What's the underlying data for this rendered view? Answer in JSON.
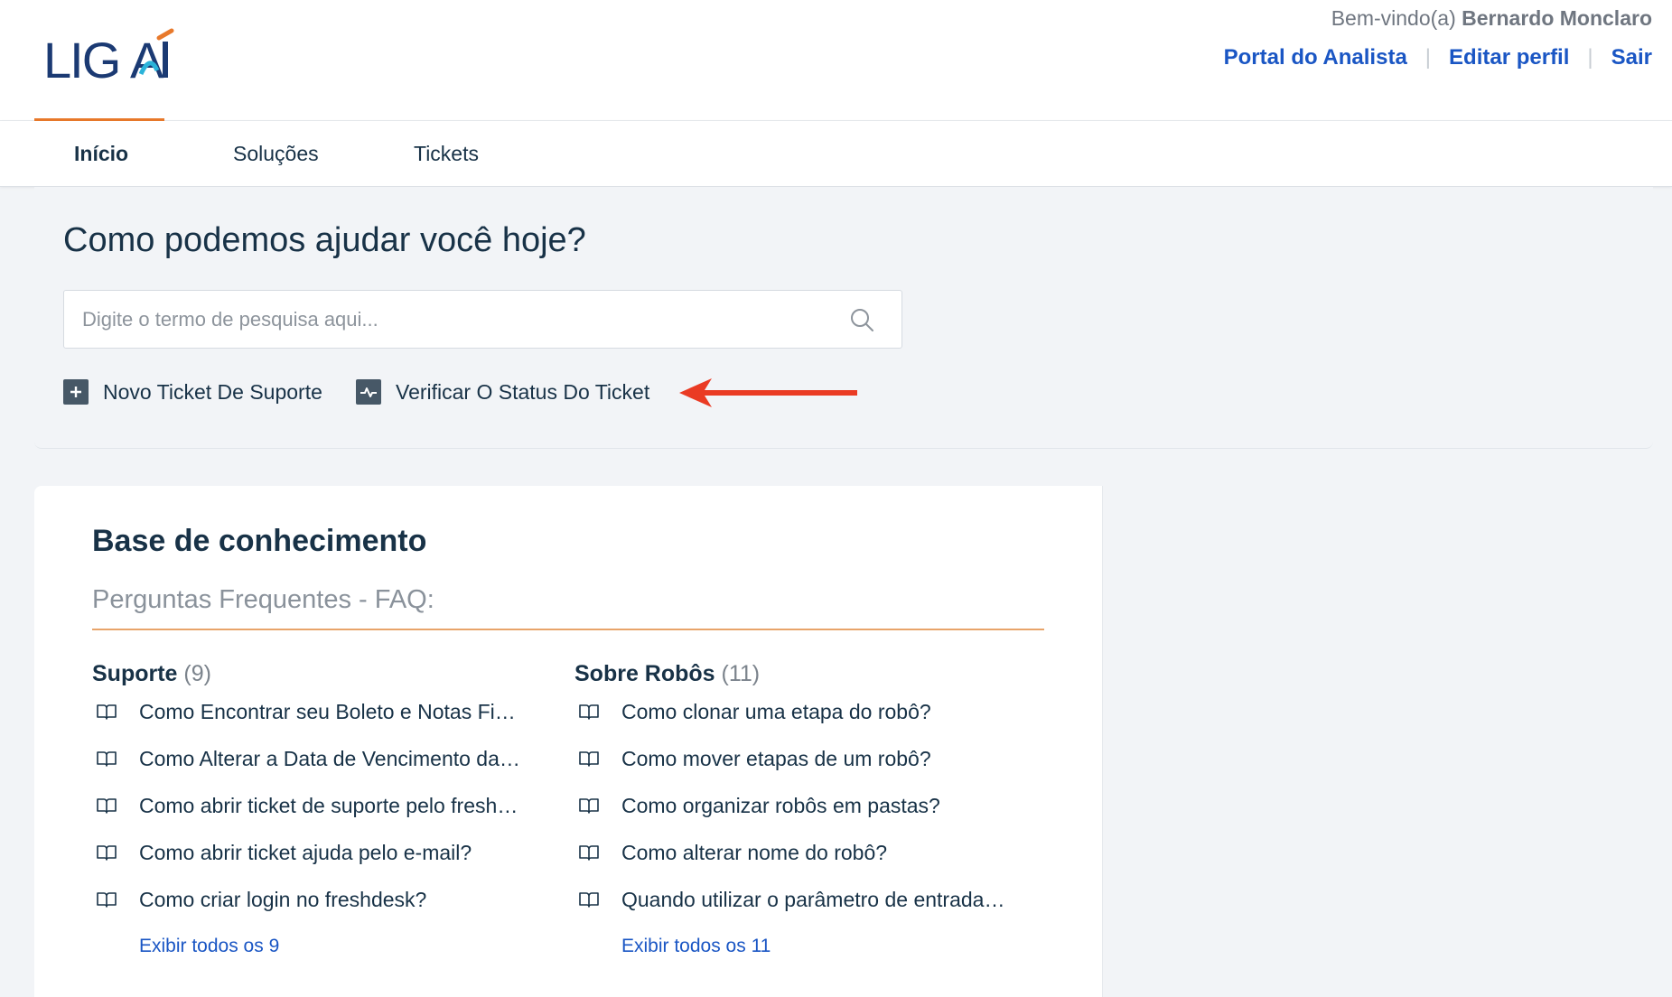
{
  "brand": {
    "logo_text": "LIGAÍ",
    "colors": {
      "blue": "#1b3a73",
      "accent_orange": "#e8792b",
      "accent_cyan": "#2bb3d9"
    }
  },
  "user": {
    "welcome_prefix": "Bem-vindo(a)",
    "name": "Bernardo Monclaro"
  },
  "top_links": {
    "portal": "Portal do Analista",
    "edit_profile": "Editar perfil",
    "logout": "Sair",
    "separator": "|"
  },
  "tabs": [
    {
      "label": "Início",
      "active": true
    },
    {
      "label": "Soluções",
      "active": false
    },
    {
      "label": "Tickets",
      "active": false
    }
  ],
  "hero": {
    "title": "Como podemos ajudar você hoje?",
    "search_placeholder": "Digite o termo de pesquisa aqui...",
    "actions": [
      {
        "label": "Novo Ticket De Suporte",
        "icon": "plus-icon"
      },
      {
        "label": "Verificar O Status Do Ticket",
        "icon": "pulse-icon"
      }
    ],
    "annotation": "red-arrow-icon"
  },
  "kb": {
    "title": "Base de conhecimento",
    "subtitle": "Perguntas Frequentes - FAQ:",
    "categories": [
      {
        "name": "Suporte",
        "count": "(9)",
        "articles": [
          "Como Encontrar seu Boleto e Notas Fiscais...",
          "Como Alterar a Data de Vencimento das Fa...",
          "Como abrir ticket de suporte pelo freshdesk?",
          "Como abrir ticket ajuda pelo e-mail?",
          "Como criar login no freshdesk?"
        ],
        "view_all": "Exibir todos os 9"
      },
      {
        "name": "Sobre Robôs",
        "count": "(11)",
        "articles": [
          "Como clonar uma etapa do robô?",
          "Como mover etapas de um robô?",
          "Como organizar robôs em pastas?",
          "Como alterar nome do robô?",
          "Quando utilizar o parâmetro de entrada “D..."
        ],
        "view_all": "Exibir todos os 11"
      }
    ]
  }
}
